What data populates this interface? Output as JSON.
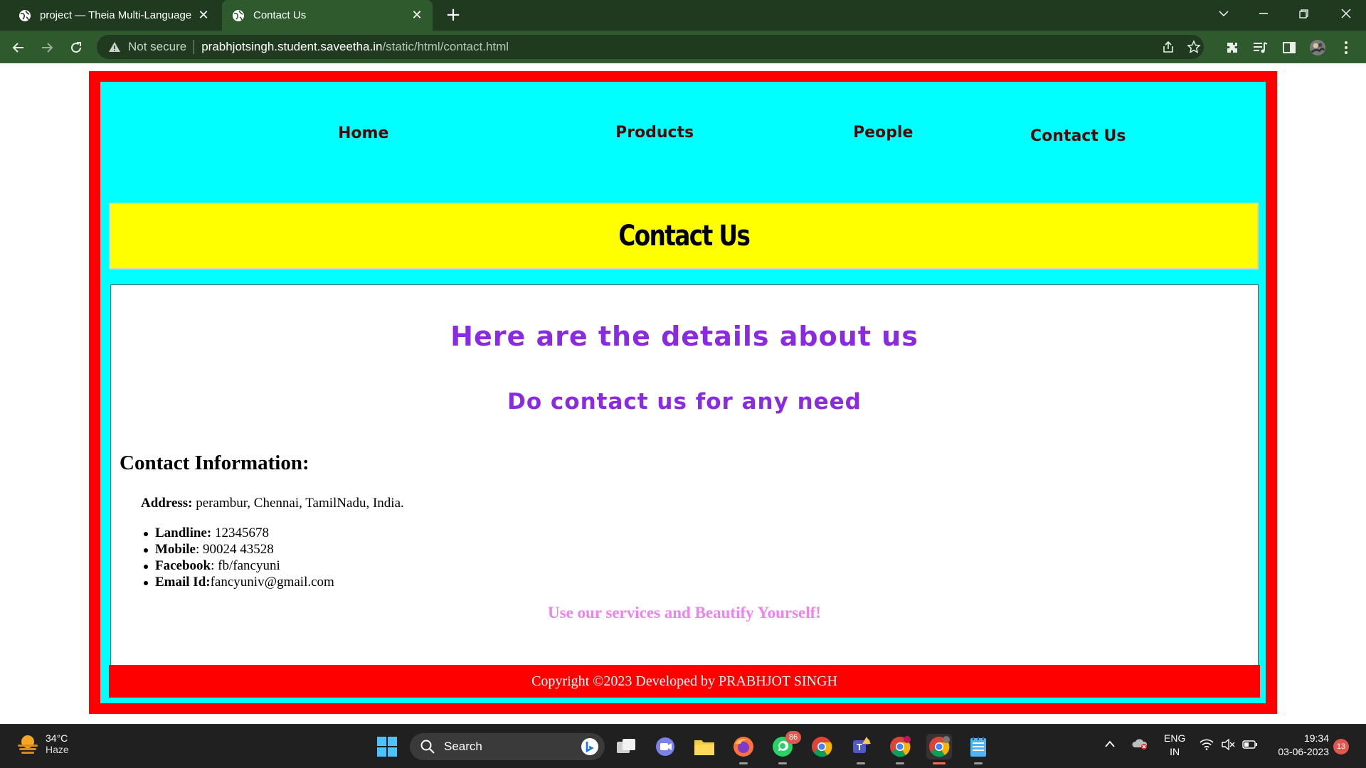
{
  "browser": {
    "tabs": [
      {
        "title": "project — Theia Multi-Language",
        "active": false
      },
      {
        "title": "Contact Us",
        "active": true
      }
    ],
    "security_label": "Not secure",
    "url_host": "prabhjotsingh.student.saveetha.in",
    "url_path": "/static/html/contact.html"
  },
  "nav": {
    "home": "Home",
    "products": "Products",
    "people": "People",
    "contact": "Contact Us"
  },
  "hero": {
    "title": "Contact Us"
  },
  "content": {
    "heading1": "Here are the details about us",
    "heading2": "Do contact us for any need",
    "section_title": "Contact Information:",
    "address_label": "Address:",
    "address_value": " perambur, Chennai, TamilNadu, India.",
    "items": [
      {
        "label": "Landline:",
        "value": " 12345678"
      },
      {
        "label": "Mobile",
        "value": ": 90024 43528"
      },
      {
        "label": "Facebook",
        "value": ": fb/fancyuni"
      },
      {
        "label": "Email Id:",
        "value": "fancyuniv@gmail.com"
      }
    ],
    "tagline": "Use our services and Beautify Yourself!"
  },
  "footer": {
    "text": "Copyright ©2023 Developed by PRABHJOT SINGH"
  },
  "taskbar": {
    "weather_temp": "34°C",
    "weather_condition": "Haze",
    "search_label": "Search",
    "whatsapp_badge": "86",
    "lang_top": "ENG",
    "lang_bottom": "IN",
    "time": "19:34",
    "date": "03-06-2023",
    "notification_count": "13"
  },
  "colors": {
    "frame": "#ff0000",
    "page_bg": "#00ffff",
    "hero_bg": "#ffff00",
    "heading": "#8a2be2",
    "tagline": "#ee82ee",
    "nav_text": "#4a0a0a"
  }
}
